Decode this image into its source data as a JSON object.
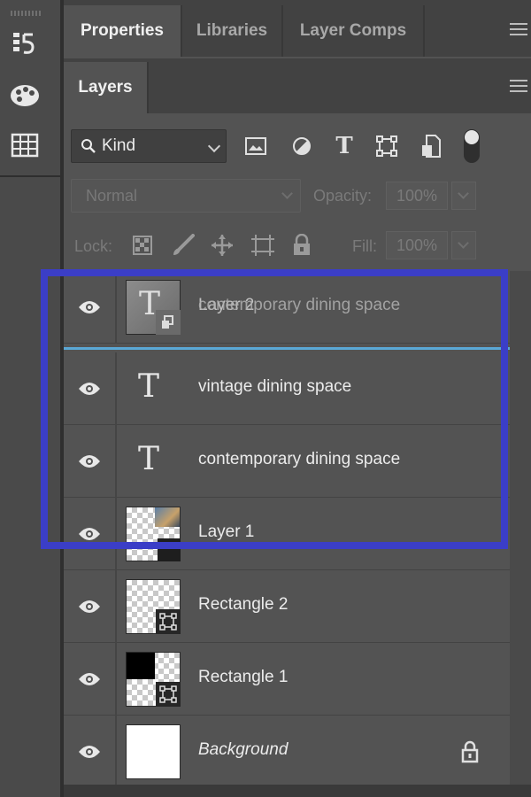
{
  "colors": {
    "highlight": "#3b3ec7",
    "drop_indicator": "#5aa8d6"
  },
  "toolbar": {
    "tools": [
      {
        "icon": "history-icon"
      },
      {
        "icon": "palette-icon"
      },
      {
        "icon": "swatches-grid-icon"
      }
    ]
  },
  "top_tabs": [
    {
      "label": "Properties",
      "active": true
    },
    {
      "label": "Libraries",
      "active": false
    },
    {
      "label": "Layer Comps",
      "active": false
    }
  ],
  "layers_tab": {
    "label": "Layers"
  },
  "filter": {
    "kind_label": "Kind",
    "icons": [
      "image-filter-icon",
      "adjustment-filter-icon",
      "type-filter-icon",
      "shape-filter-icon",
      "smart-object-filter-icon"
    ]
  },
  "blend": {
    "mode": "Normal",
    "opacity_label": "Opacity:",
    "opacity_value": "100%"
  },
  "lock": {
    "label": "Lock:",
    "fill_label": "Fill:",
    "fill_value": "100%"
  },
  "layers": [
    {
      "name": "Layer 2",
      "ghost_name": "contemporary dining space",
      "type": "smart-object"
    },
    {
      "name": "vintage dining space",
      "type": "text"
    },
    {
      "name": "contemporary dining space",
      "type": "text"
    },
    {
      "name": "Layer 1",
      "type": "image"
    },
    {
      "name": "Rectangle 2",
      "type": "shape"
    },
    {
      "name": "Rectangle 1",
      "type": "shape"
    },
    {
      "name": "Background",
      "type": "background",
      "locked": true
    }
  ]
}
